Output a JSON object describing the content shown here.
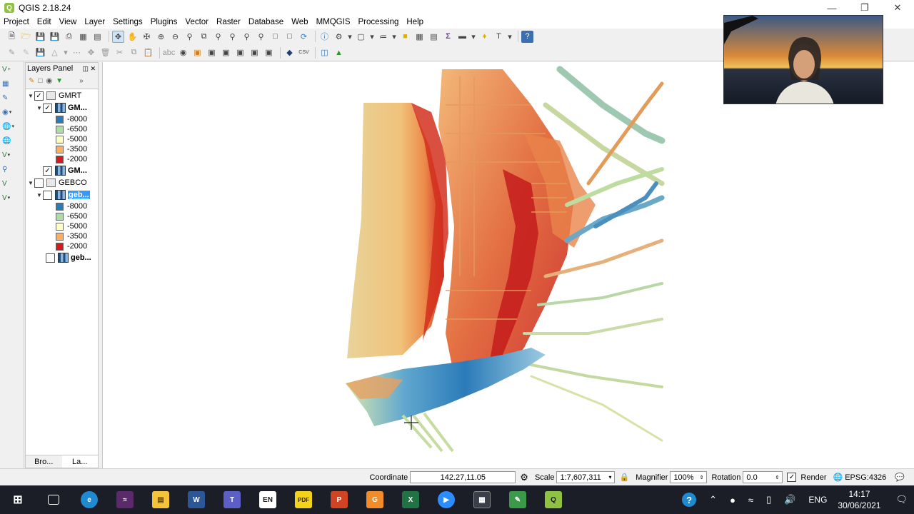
{
  "window": {
    "title": "QGIS 2.18.24"
  },
  "menu": [
    "Project",
    "Edit",
    "View",
    "Layer",
    "Settings",
    "Plugins",
    "Vector",
    "Raster",
    "Database",
    "Web",
    "MMQGIS",
    "Processing",
    "Help"
  ],
  "layers_panel": {
    "title": "Layers Panel",
    "tree": {
      "gmrt_group": "GMRT",
      "gmrt_layer1": "GM...",
      "gmrt_legend": [
        "-8000",
        "-6500",
        "-5000",
        "-3500",
        "-2000"
      ],
      "gmrt_layer2": "GM...",
      "gebco_group": "GEBCO",
      "gebco_layer1": "geb...",
      "gebco_legend": [
        "-8000",
        "-6500",
        "-5000",
        "-3500",
        "-2000"
      ],
      "gebco_layer2": "geb..."
    },
    "legend_colors": [
      "#2b7bb9",
      "#abdda4",
      "#ffffbf",
      "#fdae61",
      "#d7191c"
    ],
    "tabs": {
      "browser": "Bro...",
      "layers": "La..."
    }
  },
  "status": {
    "coordinate_label": "Coordinate",
    "coordinate_value": "142.27,11.05",
    "scale_label": "Scale",
    "scale_value": "1:7,607,311",
    "magnifier_label": "Magnifier",
    "magnifier_value": "100%",
    "rotation_label": "Rotation",
    "rotation_value": "0.0",
    "render_label": "Render",
    "crs": "EPSG:4326"
  },
  "taskbar": {
    "language": "ENG",
    "time": "14:17",
    "date": "30/06/2021"
  }
}
